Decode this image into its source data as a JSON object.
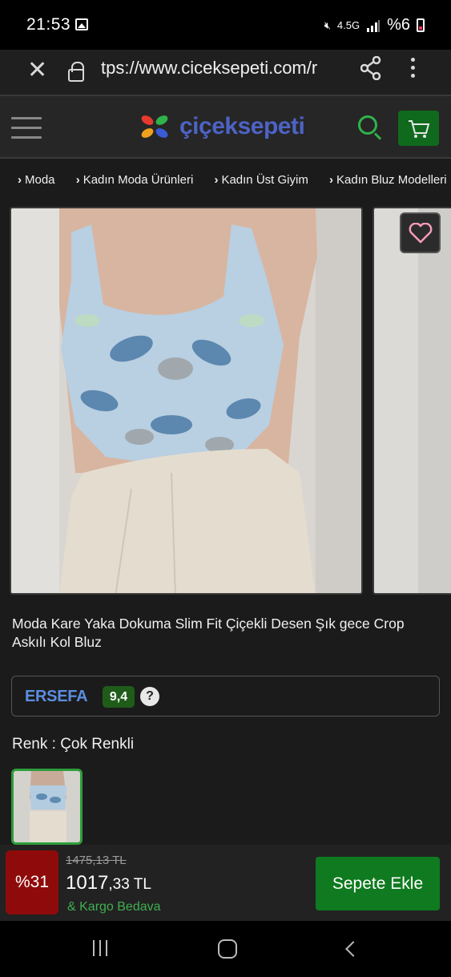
{
  "status_bar": {
    "time": "21:53",
    "battery_text": "%6",
    "network": "4.5G"
  },
  "browser": {
    "url": "tps://www.ciceksepeti.com/r"
  },
  "site": {
    "brand": "çiçeksepeti",
    "brand_color": "#4d63c5",
    "accent_green": "#2fb34a"
  },
  "breadcrumb": [
    "Moda",
    "Kadın Moda Ürünleri",
    "Kadın Üst Giyim",
    "Kadın Bluz Modelleri"
  ],
  "product": {
    "title": "Moda Kare Yaka Dokuma Slim Fit Çiçekli Desen Şık gece Crop Askılı Kol Bluz",
    "seller_name": "ERSEFA",
    "seller_score": "9,4",
    "help_icon": "?",
    "color_label": "Renk : Çok Renkli"
  },
  "buy_bar": {
    "discount": "%31",
    "old_price": "1475,13 TL",
    "price_main": "1017",
    "price_cents": ",33 TL",
    "cargo": "& Kargo Bedava",
    "add_to_cart": "Sepete Ekle"
  }
}
